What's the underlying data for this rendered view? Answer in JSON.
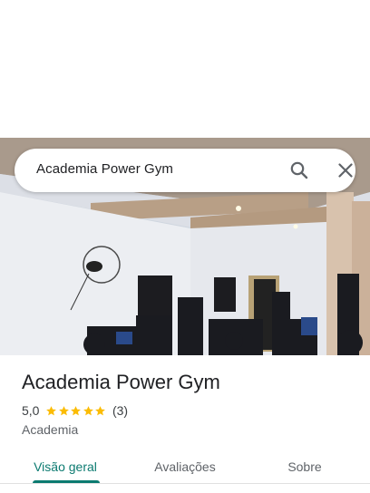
{
  "search": {
    "query": "Academia Power Gym"
  },
  "icons": {
    "search": "search-icon",
    "close": "close-icon",
    "star": "star-icon"
  },
  "place": {
    "name": "Academia Power Gym",
    "rating": "5,0",
    "stars": 5,
    "review_count": "(3)",
    "category": "Academia"
  },
  "tabs": [
    {
      "label": "Visão geral",
      "active": true
    },
    {
      "label": "Avaliações",
      "active": false
    },
    {
      "label": "Sobre",
      "active": false
    }
  ],
  "colors": {
    "accent": "#0b7a70",
    "star": "#fbbc04"
  }
}
